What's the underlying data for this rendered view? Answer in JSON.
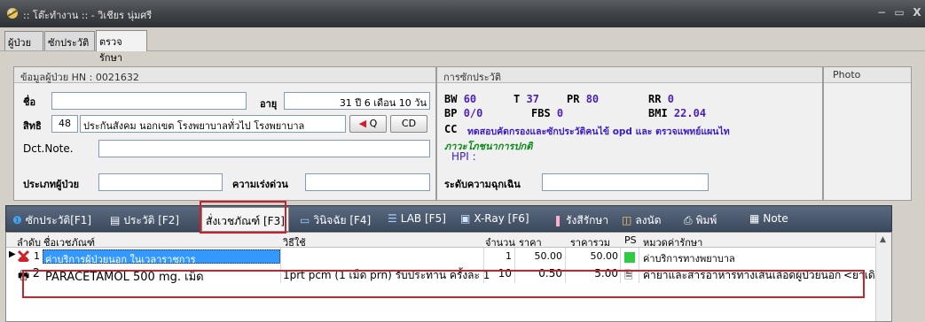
{
  "window": {
    "title": ":: โต๊ะทำงาน :: - วิเชียร นุ่มศรี",
    "minimize_glyph": "−",
    "maximize_glyph": "▭",
    "close_glyph": "X"
  },
  "top_tabs": [
    {
      "label": "ผู้ป่วย"
    },
    {
      "label": "ซักประวัติ"
    },
    {
      "label": "ตรวจรักษา"
    }
  ],
  "patient": {
    "header": "ข้อมูลผู้ป่วย HN : 0021632",
    "name_label": "ชื่อ",
    "name_value": "",
    "age_label": "อายุ",
    "age_value": "31 ปี 6 เดือน 10 วัน",
    "right_label": "สิทธิ",
    "right_code": "48",
    "right_value": "ประกันสังคม นอกเขต โรงพยาบาลทั่วไป โรงพยาบาล",
    "q_button": "Q",
    "cd_button": "CD",
    "dct_label": "Dct.Note.",
    "dct_value": "",
    "type_label": "ประเภทผู้ป่วย",
    "type_value": "",
    "urgency_label": "ความเร่งด่วน",
    "urgency_value": ""
  },
  "history": {
    "header": "การซักประวัติ",
    "bw_label": "BW",
    "bw_value": "60",
    "t_label": "T",
    "t_value": "37",
    "pr_label": "PR",
    "pr_value": "80",
    "rr_label": "RR",
    "rr_value": "0",
    "bp_label": "BP",
    "bp_value": "0/0",
    "fbs_label": "FBS",
    "fbs_value": "0",
    "bmi_label": "BMI",
    "bmi_value": "22.04",
    "cc_label": "CC",
    "cc_value": "ทดสอบคัดกรองและซักประวัติคนไข้ opd และ ตรวจแพทย์แผนไท",
    "nutrition": "ภาวะโภชนาการปกติ",
    "hpi_label": "HPI :",
    "emergency_label": "ระดับความฉุกเฉิน",
    "emergency_value": ""
  },
  "photo": {
    "header": "Photo"
  },
  "bottom_tabs": [
    {
      "label": "ซักประวัติ[F1]",
      "icon": "info-icon"
    },
    {
      "label": "ประวัติ [F2]",
      "icon": "document-icon"
    },
    {
      "label": "สั่งเวชภัณฑ์ [F3]",
      "icon": "medicine-icon"
    },
    {
      "label": "วินิจฉัย [F4]",
      "icon": "diagnosis-icon"
    },
    {
      "label": "LAB [F5]",
      "icon": "lab-icon"
    },
    {
      "label": "X-Ray [F6]",
      "icon": "xray-icon"
    },
    {
      "label": "รังสีรักษา",
      "icon": "radiation-icon"
    },
    {
      "label": "ลงนัด",
      "icon": "appointment-icon"
    },
    {
      "label": "พิมพ์",
      "icon": "print-icon"
    },
    {
      "label": "Note",
      "icon": "note-icon"
    }
  ],
  "grid": {
    "columns": [
      "ลำดับ",
      "ชื่อเวชภัณฑ์",
      "วิธีใช้",
      "จำนวน",
      "ราคา",
      "ราคารวม",
      "PS",
      "หมวดค่ารักษา"
    ],
    "rows": [
      {
        "no": "1",
        "name": "ค่าบริการผู้ป่วยนอก ในเวลาราชการ",
        "usage": "",
        "qty": "1",
        "price": "50.00",
        "total": "50.00",
        "category": "ค่าบริการทางพยาบาล",
        "extra": ""
      },
      {
        "no": "2",
        "name": "PARACETAMOL 500 mg. เม็ด",
        "usage": "1prt pcm (1 เม็ด prn) รับประทาน ครั้งละ 1",
        "qty": "10",
        "price": "0.50",
        "total": "5.00",
        "category": "ค่ายาและสารอาหารทางเส้นเลือดผู้ป่วยนอก",
        "extra": "<ยาเดิม"
      }
    ]
  },
  "colors": {
    "vital_value": "#4b1fb5",
    "cc_text": "#3d1cc2",
    "nutrition_text": "#0a8a1a",
    "selected_row": "#3399ff",
    "highlight_box": "#c8222a"
  }
}
